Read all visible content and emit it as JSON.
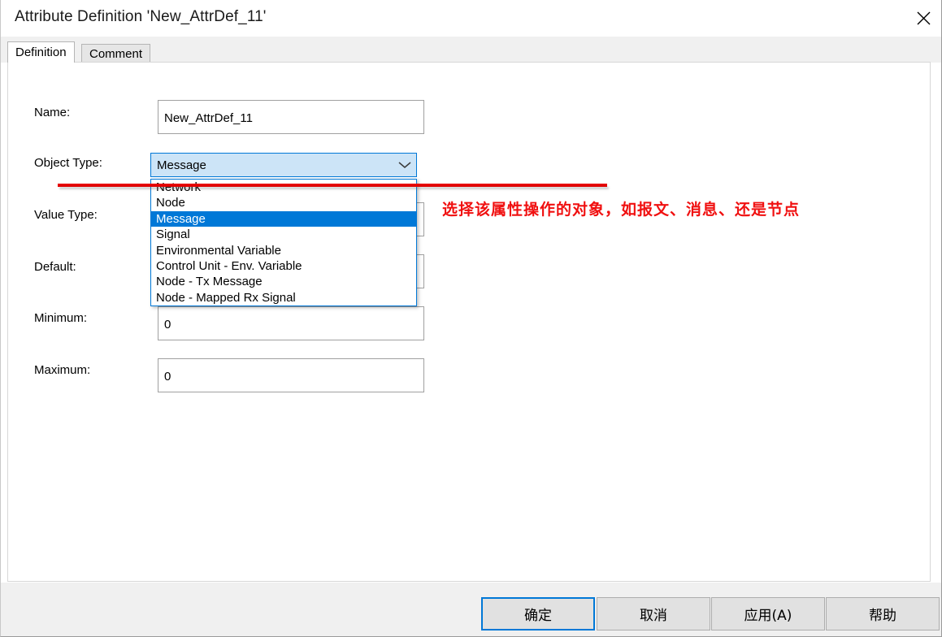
{
  "window": {
    "title": "Attribute Definition 'New_AttrDef_11'",
    "close_icon": "close-icon"
  },
  "tabs": [
    {
      "label": "Definition",
      "active": true
    },
    {
      "label": "Comment",
      "active": false
    }
  ],
  "form": {
    "fields": [
      {
        "label": "Name:",
        "value": "New_AttrDef_11",
        "type": "text"
      },
      {
        "label": "Object Type:",
        "value": "Message",
        "type": "combobox"
      },
      {
        "label": "Value Type:",
        "value": "",
        "type": "combobox"
      },
      {
        "label": "Default:",
        "value": "",
        "type": "text"
      },
      {
        "label": "Minimum:",
        "value": "0",
        "type": "text"
      },
      {
        "label": "Maximum:",
        "value": "0",
        "type": "text"
      }
    ]
  },
  "object_type_dropdown": {
    "expanded": true,
    "selected": "Message",
    "arrow_icon": "chevron-down-icon",
    "options": [
      "Network",
      "Node",
      "Message",
      "Signal",
      "Environmental Variable",
      "Control Unit - Env. Variable",
      "Node - Tx Message",
      "Node - Mapped Rx Signal"
    ]
  },
  "annotation": {
    "text": "选择该属性操作的对象，如报文、消息、还是节点",
    "color": "#f01010",
    "line_color": "#e60000"
  },
  "footer": {
    "buttons": [
      {
        "label": "确定",
        "primary": true
      },
      {
        "label": "取消",
        "primary": false
      },
      {
        "label": "应用(A)",
        "primary": false
      },
      {
        "label": "帮助",
        "primary": false
      }
    ]
  },
  "colors": {
    "accent": "#0078d7",
    "combo_fill": "#cce4f7",
    "panel_bg": "#ffffff",
    "chrome_bg": "#f0f0f0",
    "button_bg": "#e1e1e1"
  }
}
